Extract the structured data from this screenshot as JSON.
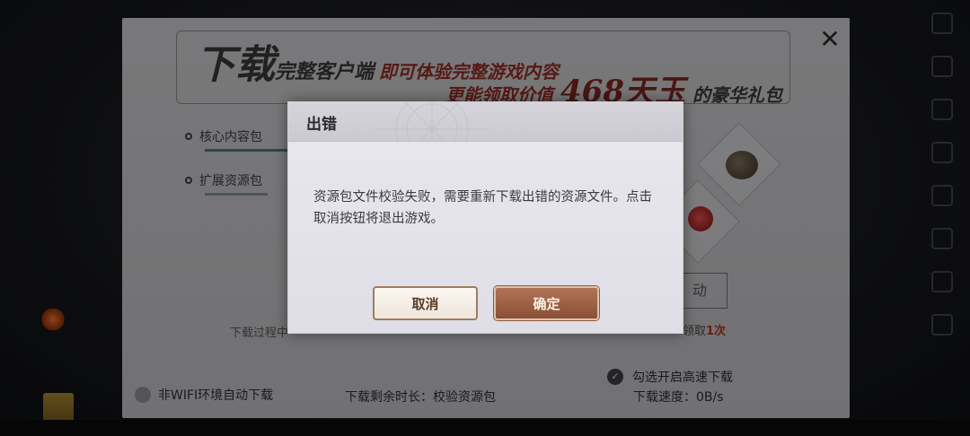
{
  "background": {
    "rail_icons": [
      "user-icon",
      "list-icon",
      "bag-icon",
      "book-icon",
      "cross-icon",
      "grid-icon",
      "download-icon",
      "menu-icon"
    ]
  },
  "panel": {
    "close_label": "✕",
    "banner": {
      "line1_big": "下载",
      "line1_sub": "完整客户端",
      "line1_red": "即可体验完整游戏内容",
      "line2_pre": "更能领取价值",
      "line2_big": "468天玉",
      "line2_post": "的豪华礼包"
    },
    "packages": [
      {
        "label": "核心内容包"
      },
      {
        "label": "扩展资源包"
      }
    ],
    "download_note": "下载过程中",
    "claim_button_fragment": "动",
    "limit_text_pre": "领取",
    "limit_text_red": "1次",
    "auto_download_label": "非WIFI环境自动下载",
    "remaining_label": "下载剩余时长：校验资源包",
    "fast_download_label": "勾选开启高速下载",
    "speed_label": "下载速度：",
    "speed_value": "0B/s"
  },
  "dialog": {
    "title": "出错",
    "message": "资源包文件校验失败，需要重新下载出错的资源文件。点击取消按钮将退出游戏。",
    "cancel_label": "取消",
    "confirm_label": "确定"
  }
}
